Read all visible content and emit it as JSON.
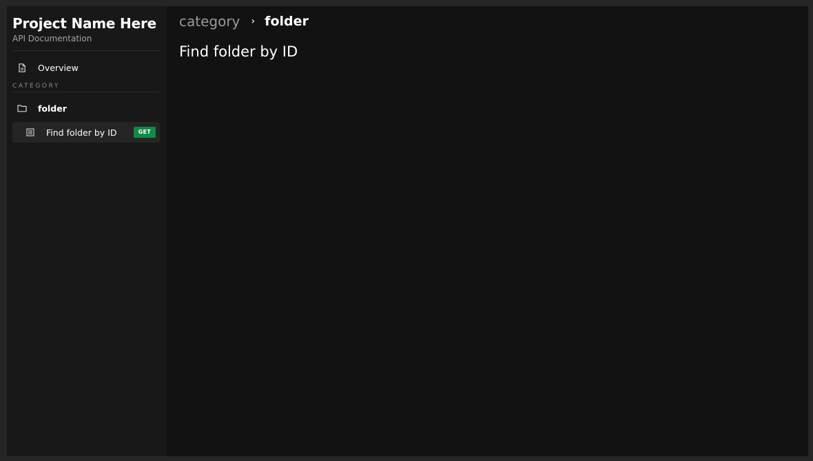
{
  "sidebar": {
    "project_title": "Project Name Here",
    "project_subtitle": "API Documentation",
    "overview": {
      "label": "Overview",
      "icon": "document-icon"
    },
    "section_label": "CATEGORY",
    "folder": {
      "label": "folder",
      "icon": "folder-icon"
    },
    "endpoint": {
      "label": "Find folder by ID",
      "icon": "list-document-icon",
      "method": "GET",
      "method_color": "#0f8a48"
    }
  },
  "breadcrumb": {
    "category": "category",
    "separator": "›",
    "current": "folder"
  },
  "main": {
    "title": "Find folder by ID"
  }
}
